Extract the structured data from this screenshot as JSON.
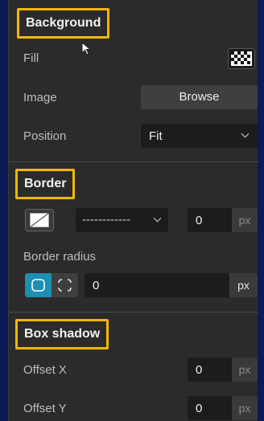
{
  "background": {
    "title": "Background",
    "fill_label": "Fill",
    "image_label": "Image",
    "browse_label": "Browse",
    "position_label": "Position",
    "position_value": "Fit"
  },
  "border": {
    "title": "Border",
    "style_value": "------------",
    "width_value": "0",
    "width_unit": "px",
    "radius_label": "Border radius",
    "radius_value": "0",
    "radius_unit": "px"
  },
  "box_shadow": {
    "title": "Box shadow",
    "offset_x_label": "Offset X",
    "offset_x_value": "0",
    "offset_x_unit": "px",
    "offset_y_label": "Offset Y",
    "offset_y_value": "0",
    "offset_y_unit": "px"
  },
  "colors": {
    "highlight": "#f2b705",
    "panel": "#2b2b2b",
    "accent": "#1e8fb0"
  }
}
